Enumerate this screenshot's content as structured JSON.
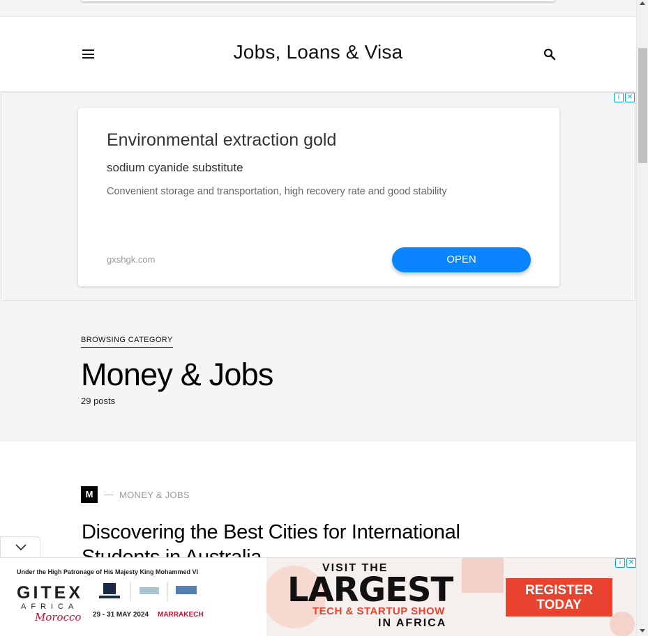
{
  "header": {
    "site_title": "Jobs, Loans & Visa"
  },
  "ad": {
    "headline": "Environmental extraction gold",
    "subheadline": "sodium cyanide substitute",
    "description": "Convenient storage and transportation, high recovery rate and good stability",
    "domain": "gxshgk.com",
    "cta": "OPEN",
    "info_glyph": "i",
    "close_glyph": "✕"
  },
  "category": {
    "kicker": "BROWSING CATEGORY",
    "title": "Money & Jobs",
    "post_count": "29 posts"
  },
  "post": {
    "badge_letter": "M",
    "dash": "—",
    "category_label": "MONEY & JOBS",
    "title": "Discovering the Best Cities for International Students in Australia"
  },
  "banner": {
    "patronage": "Under the High Patronage of His Majesty King Mohammed VI",
    "brand": "GITEX",
    "brand_sub": "AFRICA",
    "country": "Morocco",
    "dates": "29 - 31 MAY 2024",
    "city": "MARRAKECH",
    "visit": "VISIT THE",
    "largest": "LARGEST",
    "tech": "TECH & STARTUP SHOW",
    "in_africa": "IN AFRICA",
    "register": "REGISTER TODAY",
    "info_glyph": "i",
    "close_glyph": "✕"
  },
  "colors": {
    "accent_blue": "#0a84ff",
    "adchoices": "#00aecd",
    "banner_red": "#e8432f"
  }
}
